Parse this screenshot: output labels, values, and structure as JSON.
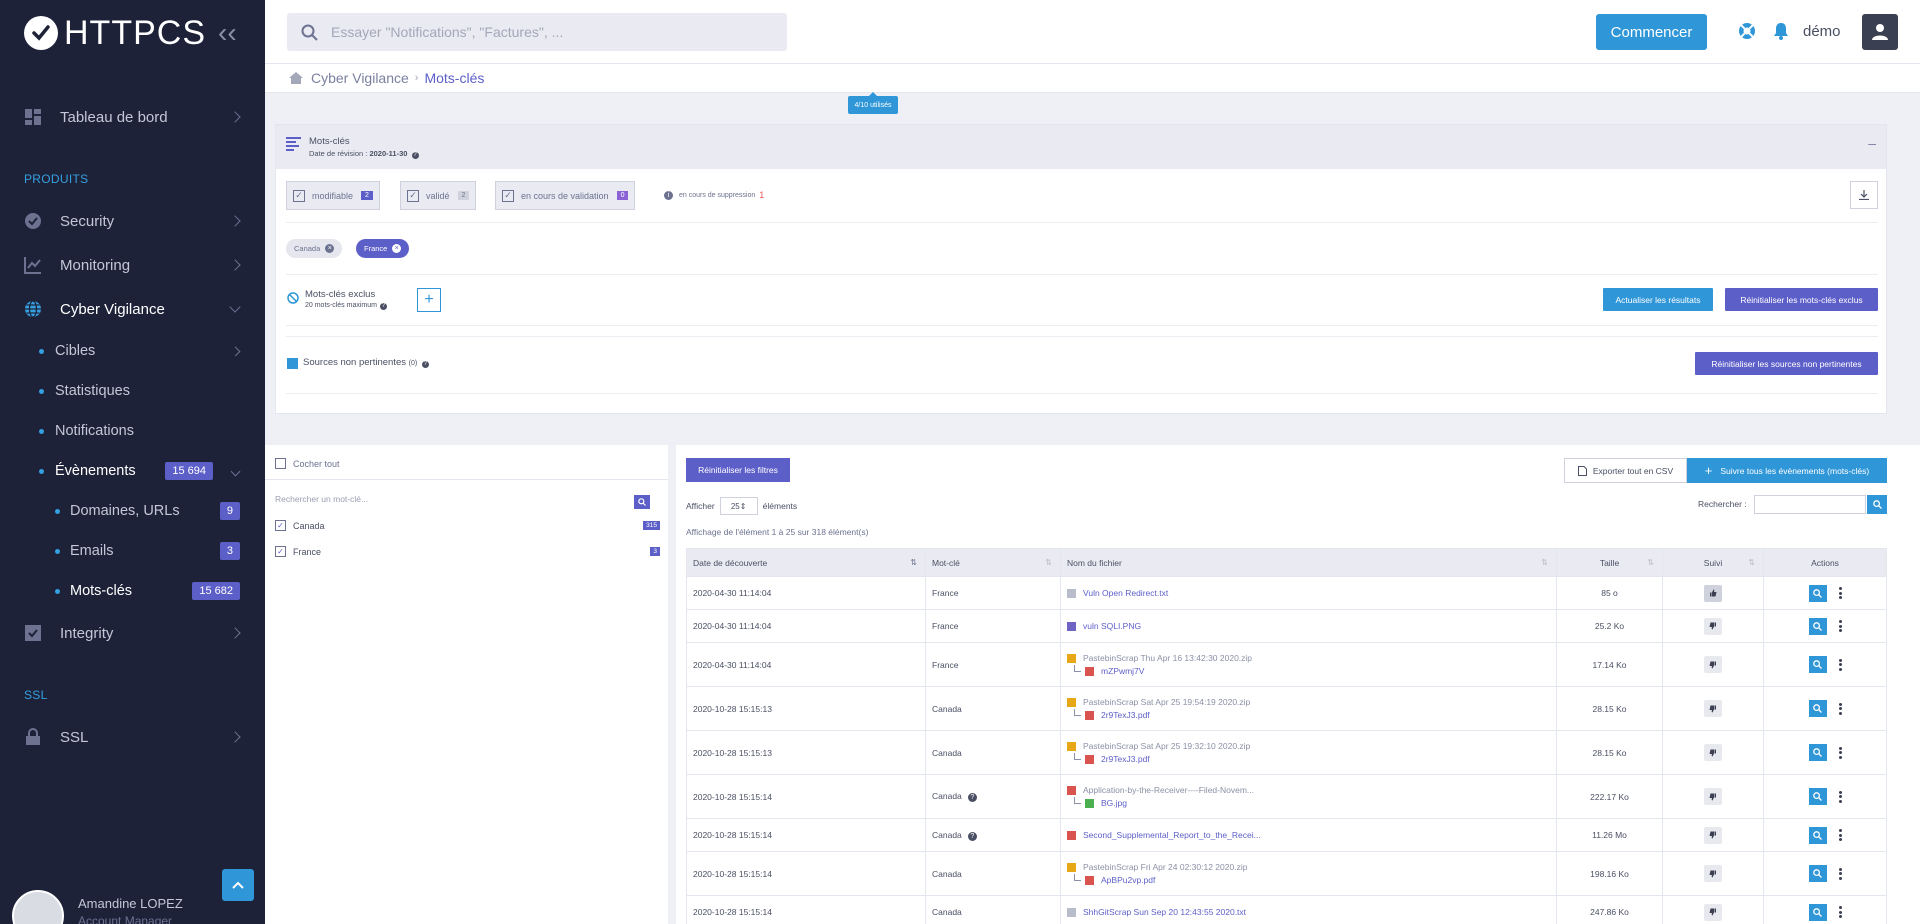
{
  "brand": {
    "name": "HTTPCS"
  },
  "sidebar": {
    "dashboard": "Tableau de bord",
    "section_products": "PRODUITS",
    "security": "Security",
    "monitoring": "Monitoring",
    "cyber": "Cyber Vigilance",
    "sub": {
      "cibles": "Cibles",
      "stats": "Statistiques",
      "notifications": "Notifications",
      "events": "Évènements",
      "events_count": "15 694",
      "domains": "Domaines, URLs",
      "domains_count": "9",
      "emails": "Emails",
      "emails_count": "3",
      "keywords": "Mots-clés",
      "keywords_count": "15 682"
    },
    "integrity": "Integrity",
    "section_ssl": "SSL",
    "ssl": "SSL",
    "user_name": "Amandine LOPEZ",
    "user_role": "Account Manager"
  },
  "topbar": {
    "search_placeholder": "Essayer \"Notifications\", \"Factures\", ...",
    "start_button": "Commencer",
    "user": "démo"
  },
  "breadcrumb": {
    "parent": "Cyber Vigilance",
    "current": "Mots-clés"
  },
  "usage_badge": "4/10 utilisés",
  "panel": {
    "title": "Mots-clés",
    "revision_label": "Date de révision :",
    "revision_date": "2020-11-30",
    "filters": [
      {
        "label": "modifiable",
        "count": "2"
      },
      {
        "label": "validé",
        "count": "2"
      },
      {
        "label": "en cours de validation",
        "count": "0"
      }
    ],
    "suppression_label": "en cours de suppression",
    "suppression_count": "1",
    "tags": [
      "Canada",
      "France"
    ],
    "excluded_title": "Mots-clés exclus",
    "excluded_sub": "20 mots-clés maximum",
    "update_button": "Actualiser les résultats",
    "reset_excluded_button": "Réinitialiser les mots-clés exclus",
    "sources_label": "Sources non pertinentes",
    "sources_count": "(0)",
    "reset_sources_button": "Réinitialiser les sources non pertinentes"
  },
  "left": {
    "check_all": "Cocher tout",
    "search_placeholder": "Rechercher un mot-clé...",
    "keywords": [
      {
        "name": "Canada",
        "count": "315"
      },
      {
        "name": "France",
        "count": "3"
      }
    ]
  },
  "right": {
    "reset_filters": "Réinitialiser les filtres",
    "export_csv": "Exporter tout en CSV",
    "follow_all": "Suivre tous les évènements (mots-clés)",
    "show_label": "Afficher",
    "show_value": "25",
    "show_suffix": "éléments",
    "search_label": "Rechercher :",
    "info": "Affichage de l'élément 1 à 25 sur 318 élément(s)",
    "columns": [
      "Date de découverte",
      "Mot-clé",
      "Nom du fichier",
      "Taille",
      "Suivi",
      "Actions"
    ],
    "rows": [
      {
        "date": "2020-04-30 11:14:04",
        "kw": "France",
        "file": "Vuln Open Redirect.txt",
        "sub": "",
        "size": "85 o",
        "q": false
      },
      {
        "date": "2020-04-30 11:14:04",
        "kw": "France",
        "file": "vuln SQLI.PNG",
        "sub": "",
        "size": "25.2 Ko",
        "q": false
      },
      {
        "date": "2020-04-30 11:14:04",
        "kw": "France",
        "file": "PastebinScrap Thu Apr 16 13:42:30 2020.zip",
        "sub": "mZPwmj7V",
        "size": "17.14 Ko",
        "q": false
      },
      {
        "date": "2020-10-28 15:15:13",
        "kw": "Canada",
        "file": "PastebinScrap Sat Apr 25 19:54:19 2020.zip",
        "sub": "2r9TexJ3.pdf",
        "size": "28.15 Ko",
        "q": false
      },
      {
        "date": "2020-10-28 15:15:13",
        "kw": "Canada",
        "file": "PastebinScrap Sat Apr 25 19:32:10 2020.zip",
        "sub": "2r9TexJ3.pdf",
        "size": "28.15 Ko",
        "q": false
      },
      {
        "date": "2020-10-28 15:15:14",
        "kw": "Canada",
        "file": "Application-by-the-Receiver----Filed-Novem...",
        "sub": "BG.jpg",
        "size": "222.17 Ko",
        "q": true
      },
      {
        "date": "2020-10-28 15:15:14",
        "kw": "Canada",
        "file": "Second_Supplemental_Report_to_the_Recei...",
        "sub": "",
        "size": "11.26 Mo",
        "q": true
      },
      {
        "date": "2020-10-28 15:15:14",
        "kw": "Canada",
        "file": "PastebinScrap Fri Apr 24 02:30:12 2020.zip",
        "sub": "ApBPu2vp.pdf",
        "size": "198.16 Ko",
        "q": false
      },
      {
        "date": "2020-10-28 15:15:14",
        "kw": "Canada",
        "file": "ShhGitScrap Sun Sep 20 12:43:55 2020.txt",
        "sub": "",
        "size": "247.86 Ko",
        "q": false
      }
    ]
  }
}
